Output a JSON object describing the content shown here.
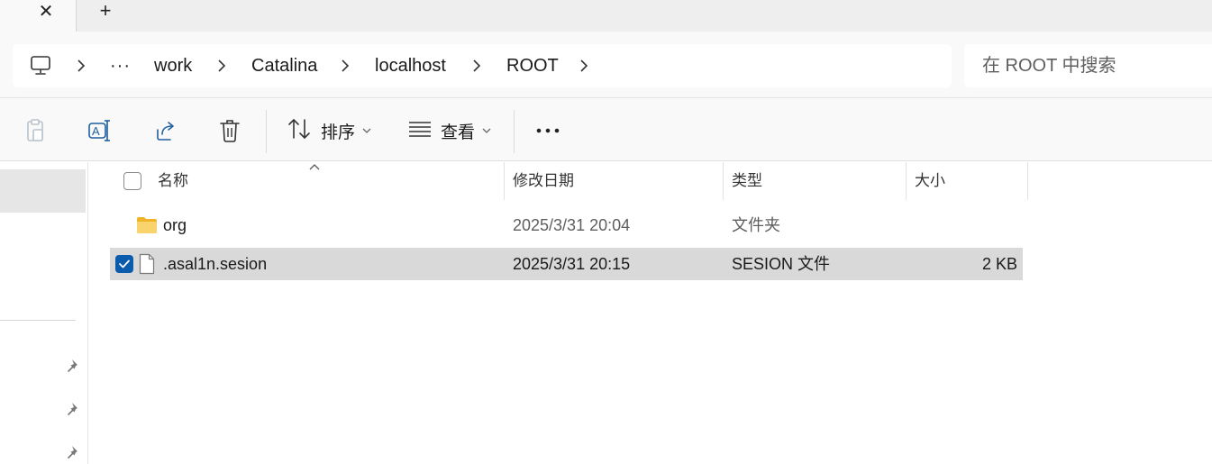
{
  "tabbar": {
    "close_glyph": "✕",
    "new_tab_glyph": "+"
  },
  "addressbar": {
    "crumbs": [
      "···",
      "work",
      "Catalina",
      "localhost",
      "ROOT"
    ],
    "icon": "computer-icon"
  },
  "search": {
    "placeholder": "在 ROOT 中搜索"
  },
  "toolbar": {
    "sort_label": "排序",
    "view_label": "查看",
    "more_glyph": "···",
    "icons": [
      "paste-icon",
      "rename-icon",
      "share-icon",
      "delete-icon",
      "sort-icon",
      "view-icon",
      "more-icon"
    ]
  },
  "columns": {
    "name": "名称",
    "modified": "修改日期",
    "type": "类型",
    "size": "大小"
  },
  "files": [
    {
      "name": "org",
      "modified": "2025/3/31 20:04",
      "type": "文件夹",
      "size": "",
      "icon": "folder-icon",
      "selected": false
    },
    {
      "name": ".asal1n.sesion",
      "modified": "2025/3/31 20:15",
      "type": "SESION 文件",
      "size": "2 KB",
      "icon": "file-icon",
      "selected": true
    }
  ],
  "colors": {
    "accent": "#0b5cad",
    "selection": "#d9d9d9",
    "folder": "#f5c542"
  }
}
